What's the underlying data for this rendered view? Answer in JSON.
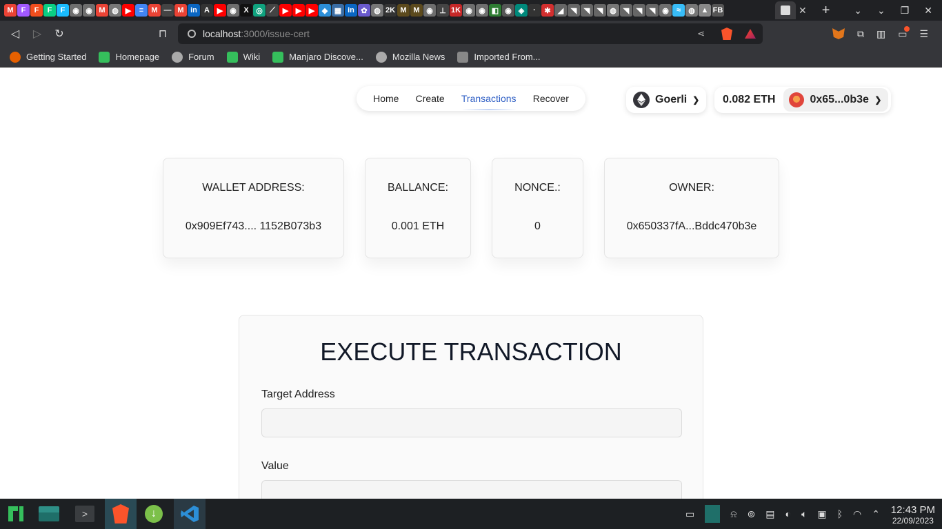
{
  "browser": {
    "tab_icons": [
      {
        "name": "gmail-icon",
        "glyph": "M",
        "color": "#ea4335"
      },
      {
        "name": "figma-icon",
        "glyph": "F",
        "color": "#a259ff"
      },
      {
        "name": "figma-icon",
        "glyph": "F",
        "color": "#f24e1e"
      },
      {
        "name": "figma-icon",
        "glyph": "F",
        "color": "#0acf83"
      },
      {
        "name": "figma-icon",
        "glyph": "F",
        "color": "#1abcfe"
      },
      {
        "name": "github-icon",
        "glyph": "◉",
        "color": "#6e6e6e"
      },
      {
        "name": "github-icon",
        "glyph": "◉",
        "color": "#6e6e6e"
      },
      {
        "name": "gmail-icon",
        "glyph": "M",
        "color": "#ea4335"
      },
      {
        "name": "globe-icon",
        "glyph": "◍",
        "color": "#777"
      },
      {
        "name": "youtube-icon",
        "glyph": "▶",
        "color": "#ff0000"
      },
      {
        "name": "docs-icon",
        "glyph": "≡",
        "color": "#4285f4"
      },
      {
        "name": "gmail-icon",
        "glyph": "M",
        "color": "#ea4335"
      },
      {
        "name": "dash-icon",
        "glyph": "—",
        "color": "#444"
      },
      {
        "name": "gmail-icon",
        "glyph": "M",
        "color": "#ea4335"
      },
      {
        "name": "linkedin-icon",
        "glyph": "in",
        "color": "#0a66c2"
      },
      {
        "name": "app-icon",
        "glyph": "A",
        "color": "#333"
      },
      {
        "name": "youtube-icon",
        "glyph": "▶",
        "color": "#ff0000"
      },
      {
        "name": "github-icon",
        "glyph": "◉",
        "color": "#6e6e6e"
      },
      {
        "name": "x-icon",
        "glyph": "X",
        "color": "#111"
      },
      {
        "name": "chatgpt-icon",
        "glyph": "◎",
        "color": "#10a37f"
      },
      {
        "name": "app-icon",
        "glyph": "⟋",
        "color": "#444"
      },
      {
        "name": "youtube-icon",
        "glyph": "▶",
        "color": "#ff0000"
      },
      {
        "name": "youtube-icon",
        "glyph": "▶",
        "color": "#ff0000"
      },
      {
        "name": "youtube-icon",
        "glyph": "▶",
        "color": "#ff0000"
      },
      {
        "name": "vscode-icon",
        "glyph": "◆",
        "color": "#2c8fd8"
      },
      {
        "name": "app-icon",
        "glyph": "▦",
        "color": "#3b6ea5"
      },
      {
        "name": "linkedin-icon",
        "glyph": "in",
        "color": "#0a66c2"
      },
      {
        "name": "app-icon",
        "glyph": "✿",
        "color": "#6a5acd"
      },
      {
        "name": "globe-icon",
        "glyph": "◍",
        "color": "#777"
      },
      {
        "name": "app-icon",
        "glyph": "2K",
        "color": "#333"
      },
      {
        "name": "medium-icon",
        "glyph": "M",
        "color": "#5c4a1d"
      },
      {
        "name": "medium-icon",
        "glyph": "M",
        "color": "#5c4a1d"
      },
      {
        "name": "github-icon",
        "glyph": "◉",
        "color": "#6e6e6e"
      },
      {
        "name": "app-icon",
        "glyph": "⊥",
        "color": "#444"
      },
      {
        "name": "app-icon",
        "glyph": "1K",
        "color": "#c62828"
      },
      {
        "name": "github-icon",
        "glyph": "◉",
        "color": "#6e6e6e"
      },
      {
        "name": "github-icon",
        "glyph": "◉",
        "color": "#6e6e6e"
      },
      {
        "name": "app-icon",
        "glyph": "◧",
        "color": "#2e7d32"
      },
      {
        "name": "app-icon",
        "glyph": "◉",
        "color": "#555"
      },
      {
        "name": "app-icon",
        "glyph": "◈",
        "color": "#00897b"
      },
      {
        "name": "app-icon",
        "glyph": "·",
        "color": "#333"
      },
      {
        "name": "app-icon",
        "glyph": "✱",
        "color": "#d32f2f"
      },
      {
        "name": "app-icon",
        "glyph": "◢",
        "color": "#666"
      },
      {
        "name": "app-icon",
        "glyph": "◥",
        "color": "#666"
      },
      {
        "name": "app-icon",
        "glyph": "◥",
        "color": "#666"
      },
      {
        "name": "app-icon",
        "glyph": "◥",
        "color": "#666"
      },
      {
        "name": "globe-icon",
        "glyph": "◍",
        "color": "#777"
      },
      {
        "name": "app-icon",
        "glyph": "◥",
        "color": "#666"
      },
      {
        "name": "app-icon",
        "glyph": "◥",
        "color": "#666"
      },
      {
        "name": "app-icon",
        "glyph": "◥",
        "color": "#666"
      },
      {
        "name": "github-icon",
        "glyph": "◉",
        "color": "#6e6e6e"
      },
      {
        "name": "tailwind-icon",
        "glyph": "≈",
        "color": "#38bdf8"
      },
      {
        "name": "globe-icon",
        "glyph": "◍",
        "color": "#777"
      },
      {
        "name": "app-icon",
        "glyph": "▲",
        "color": "#888"
      },
      {
        "name": "app-icon",
        "glyph": "FB",
        "color": "#555"
      }
    ],
    "url_host": "localhost",
    "url_path": ":3000/issue-cert",
    "bookmarks": [
      {
        "label": "Getting Started",
        "icon": "firefox-icon",
        "color": "#e66000"
      },
      {
        "label": "Homepage",
        "icon": "manjaro-icon",
        "color": "#35bf5c"
      },
      {
        "label": "Forum",
        "icon": "globe-icon",
        "color": "#aaa"
      },
      {
        "label": "Wiki",
        "icon": "manjaro-icon",
        "color": "#35bf5c"
      },
      {
        "label": "Manjaro Discove...",
        "icon": "manjaro-icon",
        "color": "#35bf5c"
      },
      {
        "label": "Mozilla News",
        "icon": "globe-icon",
        "color": "#aaa"
      },
      {
        "label": "Imported From...",
        "icon": "folder-icon",
        "color": "#888"
      }
    ]
  },
  "nav": {
    "home": "Home",
    "create": "Create",
    "transactions": "Transactions",
    "recover": "Recover"
  },
  "network": {
    "label": "Goerli"
  },
  "account": {
    "balance": "0.082 ETH",
    "address": "0x65...0b3e"
  },
  "cards": {
    "wallet": {
      "label": "WALLET ADDRESS:",
      "value": "0x909Ef743.... 1152B073b3"
    },
    "balance": {
      "label": "BALLANCE:",
      "value": "0.001 ETH"
    },
    "nonce": {
      "label": "NONCE.:",
      "value": "0"
    },
    "owner": {
      "label": "OWNER:",
      "value": "0x650337fA...Bddc470b3e"
    }
  },
  "execute": {
    "title": "EXECUTE TRANSACTION",
    "target_label": "Target Address",
    "target_value": "",
    "value_label": "Value",
    "value_value": ""
  },
  "taskbar": {
    "clock_time": "12:43 PM",
    "clock_date": "22/09/2023"
  }
}
